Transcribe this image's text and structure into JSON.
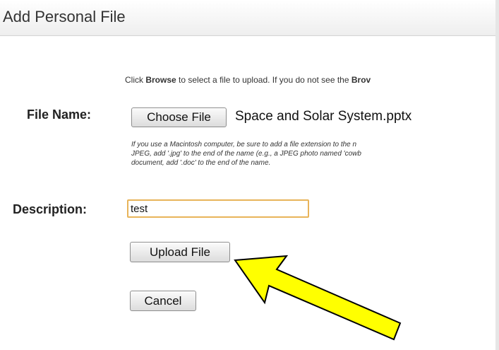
{
  "header": {
    "title": "Add Personal File"
  },
  "instructions": {
    "prefix": "Click ",
    "browse_word": "Browse",
    "middle": " to select a file to upload. If you do not see the ",
    "browse_word_2": "Brov"
  },
  "file_name": {
    "label": "File Name:",
    "choose_button": "Choose File",
    "selected_file": "Space and Solar System.pptx",
    "help_lines": [
      "If you use a Macintosh computer, be sure to add a file extension to the n",
      "JPEG, add '.jpg' to the end of the name (e.g., a JPEG photo named 'cowb",
      "document, add '.doc' to the end of the name."
    ]
  },
  "description": {
    "label": "Description:",
    "value": "test"
  },
  "actions": {
    "upload_label": "Upload File",
    "cancel_label": "Cancel"
  },
  "colors": {
    "arrow_fill": "#ffff00",
    "arrow_stroke": "#000000",
    "input_border": "#e8b45a"
  },
  "annotation": {
    "icon": "arrow-pointing-to-upload-icon"
  }
}
